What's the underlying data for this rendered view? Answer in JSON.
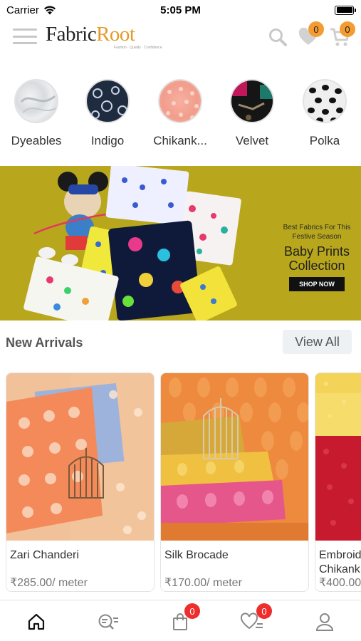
{
  "status_bar": {
    "carrier": "Carrier",
    "time": "5:05 PM"
  },
  "header": {
    "logo_fabric": "Fabric",
    "logo_root": "Root",
    "logo_tagline": "Fashion · Quality · Confidence",
    "wishlist_count": "0",
    "cart_count": "0",
    "badge_color": "#f39c32"
  },
  "categories": [
    {
      "label": "Dyeables",
      "icon": "dyeables-fabric-thumbnail"
    },
    {
      "label": "Indigo",
      "icon": "indigo-fabric-thumbnail"
    },
    {
      "label": "Chikank...",
      "icon": "chikankari-fabric-thumbnail"
    },
    {
      "label": "Velvet",
      "icon": "velvet-fabric-thumbnail"
    },
    {
      "label": "Polka",
      "icon": "polka-fabric-thumbnail"
    }
  ],
  "banner": {
    "line1": "Best Fabrics For This",
    "line1b": "Festive Season",
    "line2": "Baby Prints",
    "line3": "Collection",
    "cta": "SHOP NOW",
    "background_color": "#b8a71c"
  },
  "new_arrivals": {
    "title": "New Arrivals",
    "view_all": "View All",
    "products": [
      {
        "name": "Zari Chanderi",
        "price": "₹285.00/ meter"
      },
      {
        "name": "Silk Brocade",
        "price": "₹170.00/ meter"
      },
      {
        "name": "Embroid",
        "name2": "Chikank",
        "price": "₹400.00"
      }
    ]
  },
  "tabbar": {
    "tabs": [
      {
        "icon": "home-icon"
      },
      {
        "icon": "search-list-icon"
      },
      {
        "icon": "bag-icon",
        "badge": "0"
      },
      {
        "icon": "wishlist-icon",
        "badge": "0"
      },
      {
        "icon": "profile-icon"
      }
    ],
    "badge_color": "#ee2d2d"
  }
}
